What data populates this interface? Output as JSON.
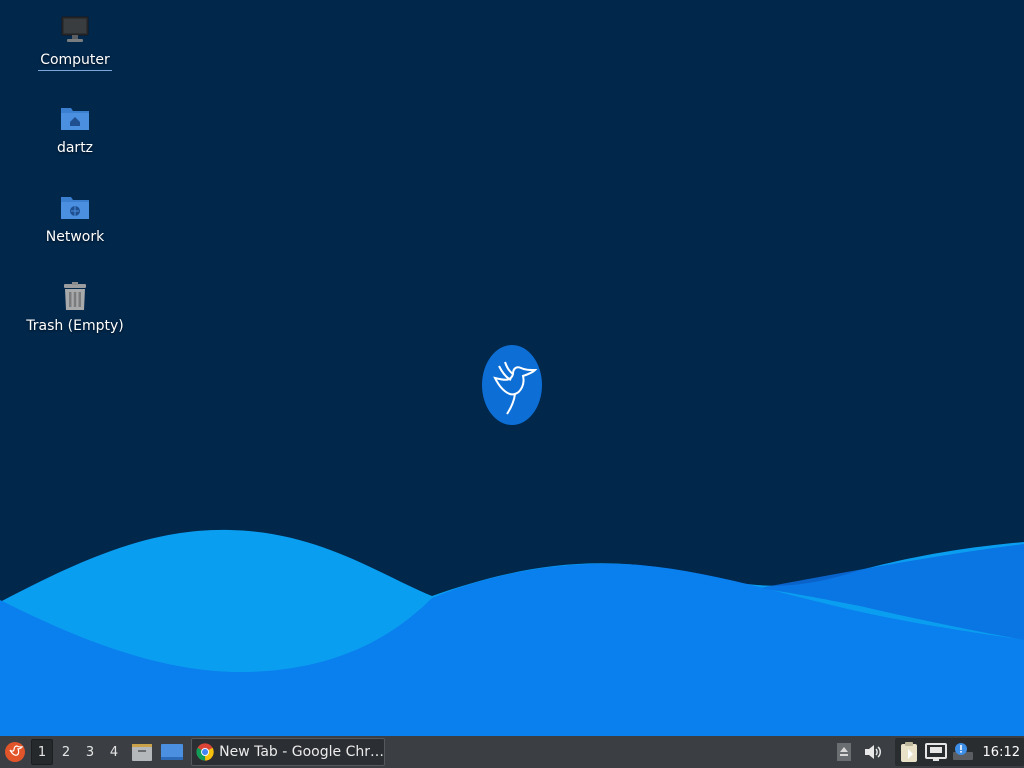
{
  "desktop": {
    "icons": [
      {
        "label": "Computer"
      },
      {
        "label": "dartz"
      },
      {
        "label": "Network"
      },
      {
        "label": "Trash (Empty)"
      }
    ],
    "colors": {
      "background": "#01274b",
      "wave_light": "#0aa3ef",
      "wave_main": "#0a7ff0",
      "folder": "#4a8fe0"
    }
  },
  "taskbar": {
    "workspaces": [
      "1",
      "2",
      "3",
      "4"
    ],
    "active_workspace": "1",
    "task": {
      "title": "New Tab - Google Chr…"
    },
    "clock": "16:12"
  }
}
